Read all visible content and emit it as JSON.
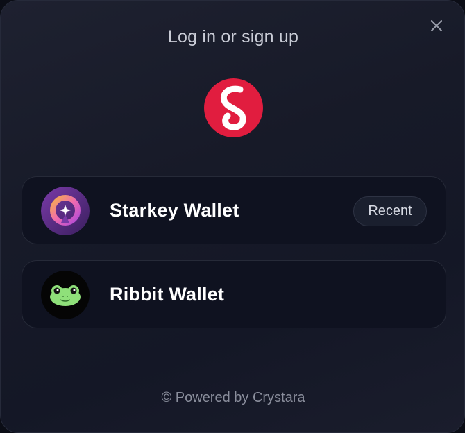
{
  "dialog": {
    "title": "Log in or sign up",
    "close_icon": "close-icon",
    "logo_icon": "crystara-logo-icon"
  },
  "wallets": [
    {
      "label": "Starkey Wallet",
      "icon": "starkey-wallet-icon",
      "badge": "Recent"
    },
    {
      "label": "Ribbit Wallet",
      "icon": "ribbit-wallet-icon"
    }
  ],
  "footer": {
    "text": "© Powered by Crystara"
  },
  "colors": {
    "accent_red": "#e11d3f",
    "background": "#171a28",
    "frog_green": "#8fe07a"
  }
}
